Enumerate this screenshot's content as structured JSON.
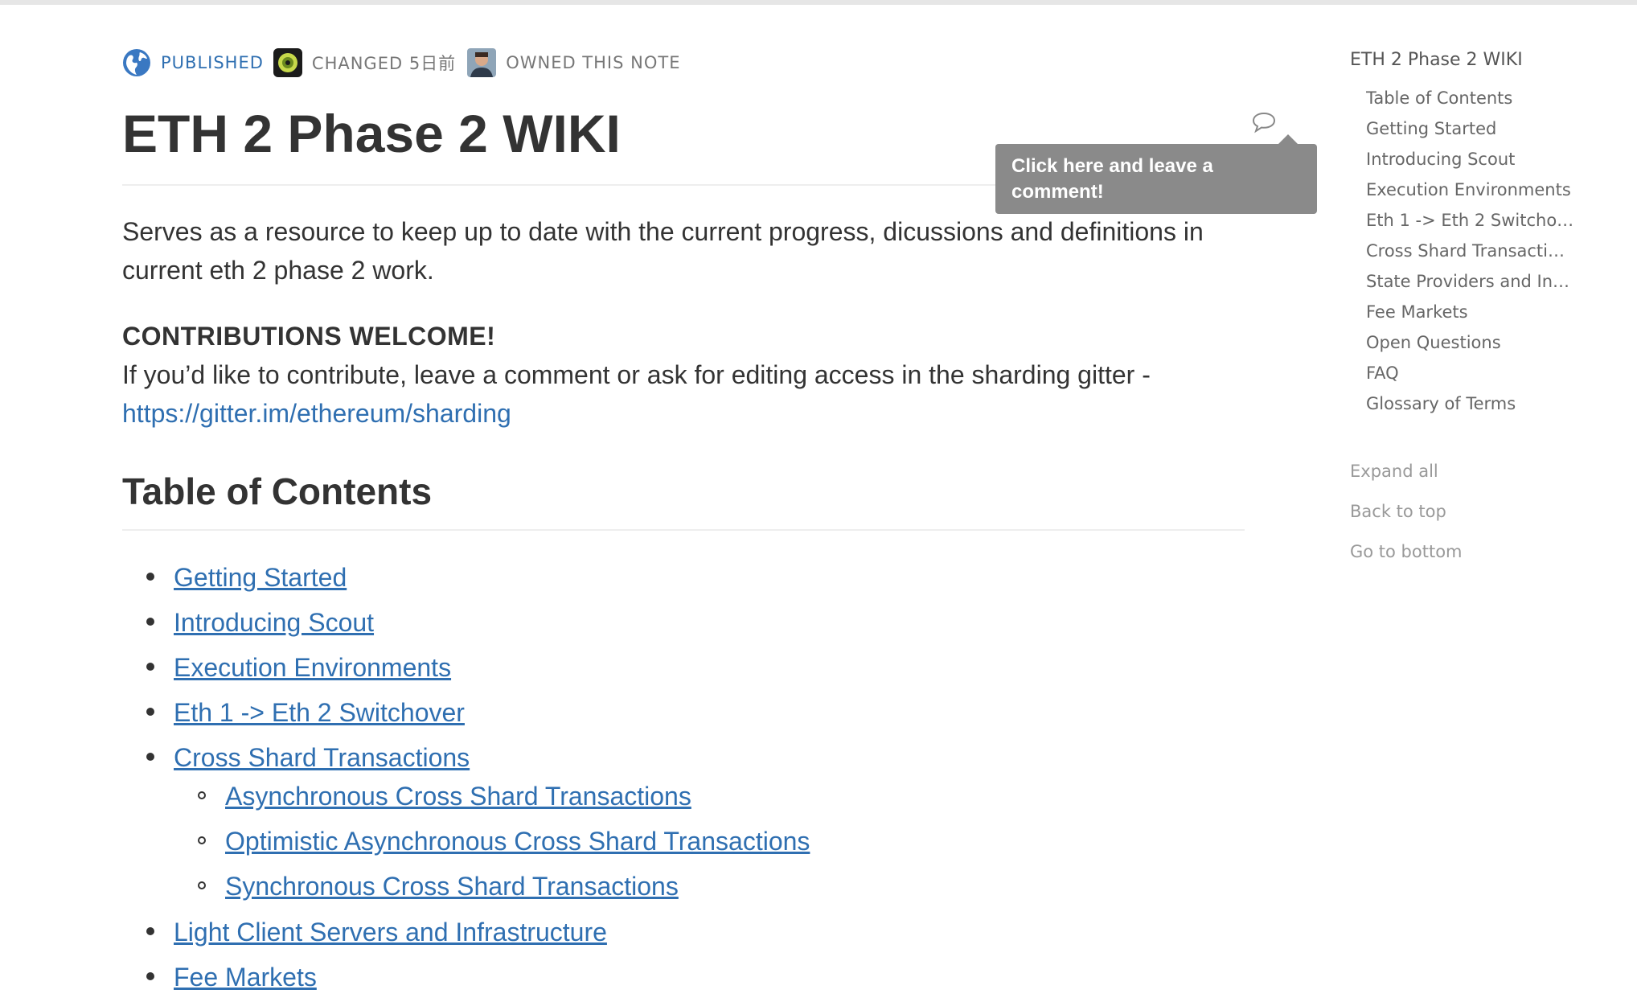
{
  "meta": {
    "published": "PUBLISHED",
    "changed": "CHANGED 5日前",
    "owned": "OWNED THIS NOTE"
  },
  "page": {
    "title": "ETH 2 Phase 2 WIKI",
    "intro": "Serves as a resource to keep up to date with the current progress, dicussions and definitions in current eth 2 phase 2 work.",
    "contrib_heading": "CONTRIBUTIONS WELCOME!",
    "contrib_text": "If you’d like to contribute, leave a comment or ask for editing access in the sharding gitter -",
    "contrib_link": "https://gitter.im/ethereum/sharding"
  },
  "tooltip": {
    "text": "Click here and leave a comment!"
  },
  "toc": {
    "heading": "Table of Contents",
    "items": [
      "Getting Started",
      "Introducing Scout",
      "Execution Environments",
      "Eth 1 -> Eth 2 Switchover",
      "Cross Shard Transactions",
      "Asynchronous Cross Shard Transactions",
      "Optimistic Asynchronous Cross Shard Transactions",
      "Synchronous Cross Shard Transactions",
      "Light Client Servers and Infrastructure",
      "Fee Markets"
    ]
  },
  "sidebar": {
    "title": "ETH 2 Phase 2 WIKI",
    "items": [
      "Table of Contents",
      "Getting Started",
      "Introducing Scout",
      "Execution Environments",
      "Eth 1 -> Eth 2 Switcho…",
      "Cross Shard Transacti…",
      "State Providers and In…",
      "Fee Markets",
      "Open Questions",
      "FAQ",
      "Glossary of Terms"
    ],
    "expand_all": "Expand all",
    "back_to_top": "Back to top",
    "go_to_bottom": "Go to bottom"
  },
  "colors": {
    "link": "#2f6fb1",
    "text": "#333333",
    "tooltip_bg": "#8a8a8a"
  }
}
